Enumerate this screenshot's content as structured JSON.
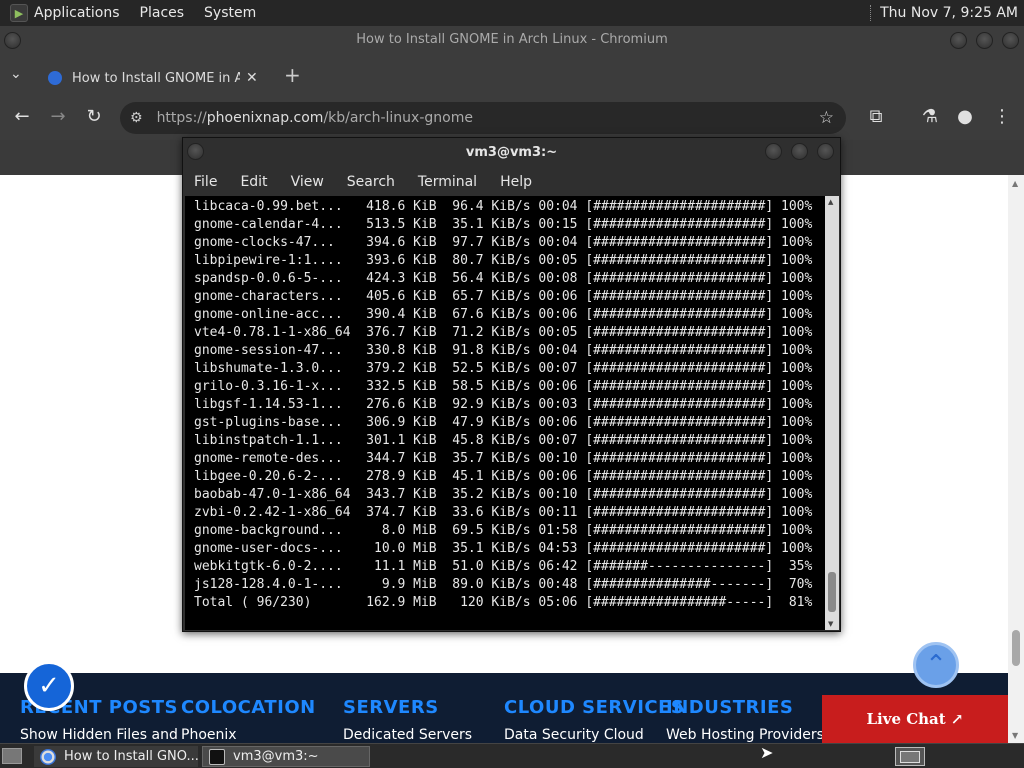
{
  "top_panel": {
    "menus": [
      "Applications",
      "Places",
      "System"
    ],
    "clock": "Thu Nov  7,  9:25 AM"
  },
  "browser": {
    "window_title": "How to Install GNOME in Arch Linux - Chromium",
    "tab": {
      "title": "How to Install GNOME in Arc",
      "favicon": "phoenixnap-favicon"
    },
    "url": {
      "scheme": "https://",
      "domain": "phoenixnap.com",
      "path": "/kb/arch-linux-gnome"
    }
  },
  "footer": {
    "columns": [
      {
        "title": "RECENT POSTS",
        "item": "Show Hidden Files and"
      },
      {
        "title": "COLOCATION",
        "item": "Phoenix"
      },
      {
        "title": "SERVERS",
        "item": "Dedicated Servers"
      },
      {
        "title": "CLOUD SERVICES",
        "item": "Data Security Cloud"
      },
      {
        "title": "INDUSTRIES",
        "item": "Web Hosting Providers"
      }
    ],
    "live_chat": "Live Chat ↗"
  },
  "terminal": {
    "title": "vm3@vm3:~",
    "menu": [
      "File",
      "Edit",
      "View",
      "Search",
      "Terminal",
      "Help"
    ],
    "lines": [
      "libcaca-0.99.bet...   418.6 KiB  96.4 KiB/s 00:04 [######################] 100%",
      "gnome-calendar-4...   513.5 KiB  35.1 KiB/s 00:15 [######################] 100%",
      "gnome-clocks-47...    394.6 KiB  97.7 KiB/s 00:04 [######################] 100%",
      "libpipewire-1:1....   393.6 KiB  80.7 KiB/s 00:05 [######################] 100%",
      "spandsp-0.0.6-5-...   424.3 KiB  56.4 KiB/s 00:08 [######################] 100%",
      "gnome-characters...   405.6 KiB  65.7 KiB/s 00:06 [######################] 100%",
      "gnome-online-acc...   390.4 KiB  67.6 KiB/s 00:06 [######################] 100%",
      "vte4-0.78.1-1-x86_64  376.7 KiB  71.2 KiB/s 00:05 [######################] 100%",
      "gnome-session-47...   330.8 KiB  91.8 KiB/s 00:04 [######################] 100%",
      "libshumate-1.3.0...   379.2 KiB  52.5 KiB/s 00:07 [######################] 100%",
      "grilo-0.3.16-1-x...   332.5 KiB  58.5 KiB/s 00:06 [######################] 100%",
      "libgsf-1.14.53-1...   276.6 KiB  92.9 KiB/s 00:03 [######################] 100%",
      "gst-plugins-base...   306.9 KiB  47.9 KiB/s 00:06 [######################] 100%",
      "libinstpatch-1.1...   301.1 KiB  45.8 KiB/s 00:07 [######################] 100%",
      "gnome-remote-des...   344.7 KiB  35.7 KiB/s 00:10 [######################] 100%",
      "libgee-0.20.6-2-...   278.9 KiB  45.1 KiB/s 00:06 [######################] 100%",
      "baobab-47.0-1-x86_64  343.7 KiB  35.2 KiB/s 00:10 [######################] 100%",
      "zvbi-0.2.42-1-x86_64  374.7 KiB  33.6 KiB/s 00:11 [######################] 100%",
      "gnome-background...     8.0 MiB  69.5 KiB/s 01:58 [######################] 100%",
      "gnome-user-docs-...    10.0 MiB  35.1 KiB/s 04:53 [######################] 100%",
      "webkitgtk-6.0-2....    11.1 MiB  51.0 KiB/s 06:42 [#######---------------]  35%",
      "js128-128.4.0-1-...     9.9 MiB  89.0 KiB/s 00:48 [###############-------]  70%",
      "Total ( 96/230)       162.9 MiB   120 KiB/s 05:06 [#################-----]  81%"
    ]
  },
  "taskbar": {
    "tasks": [
      "How to Install GNO...",
      "vm3@vm3:~"
    ]
  }
}
